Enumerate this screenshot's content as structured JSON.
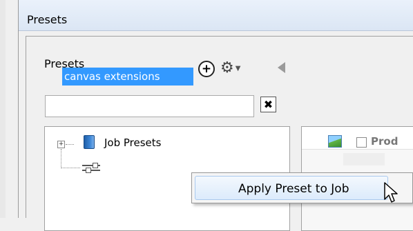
{
  "window": {
    "title": "Presets"
  },
  "panel": {
    "label": "Presets",
    "add_icon": "plus-circle-icon",
    "gear_icon": "gear-icon",
    "collapse_icon": "triangle-left-icon"
  },
  "search": {
    "value": "",
    "placeholder": "",
    "clear_glyph": "✖"
  },
  "tree": {
    "items": [
      {
        "label": "Job Presets",
        "icon": "book-icon",
        "expander": "+"
      },
      {
        "label": "canvas extensions",
        "icon": "slider-icon",
        "selected": true
      }
    ]
  },
  "right_table": {
    "header_text": "Prod"
  },
  "context_menu": {
    "items": [
      {
        "label": "Apply Preset to Job"
      }
    ]
  },
  "colors": {
    "selection": "#3399ff",
    "menu_highlight": "#dcebfc"
  }
}
